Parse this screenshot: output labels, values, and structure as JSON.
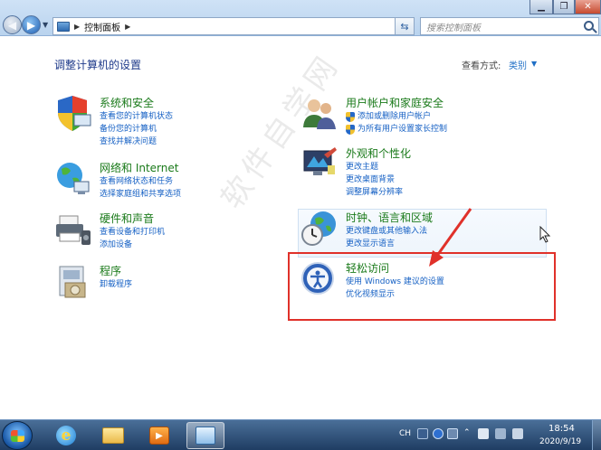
{
  "window": {
    "breadcrumb": "控制面板",
    "search_placeholder": "搜索控制面板"
  },
  "header": {
    "title": "调整计算机的设置",
    "view_by_label": "查看方式:",
    "view_by_value": "类别"
  },
  "categories": [
    {
      "title": "系统和安全",
      "links": [
        "查看您的计算机状态",
        "备份您的计算机",
        "查找并解决问题"
      ]
    },
    {
      "title": "网络和 Internet",
      "links": [
        "查看网络状态和任务",
        "选择家庭组和共享选项"
      ]
    },
    {
      "title": "硬件和声音",
      "links": [
        "查看设备和打印机",
        "添加设备"
      ]
    },
    {
      "title": "程序",
      "links": [
        "卸载程序"
      ]
    },
    {
      "title": "用户帐户和家庭安全",
      "links": [
        "添加或删除用户帐户",
        "为所有用户设置家长控制"
      ]
    },
    {
      "title": "外观和个性化",
      "links": [
        "更改主题",
        "更改桌面背景",
        "调整屏幕分辨率"
      ]
    },
    {
      "title": "时钟、语言和区域",
      "links": [
        "更改键盘或其他输入法",
        "更改显示语言"
      ]
    },
    {
      "title": "轻松访问",
      "links": [
        "使用 Windows 建议的设置",
        "优化视频显示"
      ]
    }
  ],
  "watermark": "软件自学网",
  "taskbar": {
    "lang": "CH",
    "time": "18:54",
    "date": "2020/9/19"
  },
  "icons": {
    "system": "shield-computer-icon",
    "network": "globe-network-icon",
    "hardware": "printer-icon",
    "programs": "programs-icon",
    "users": "users-icon",
    "appearance": "monitor-paint-icon",
    "clock": "clock-globe-icon",
    "ease": "ease-of-access-icon"
  }
}
